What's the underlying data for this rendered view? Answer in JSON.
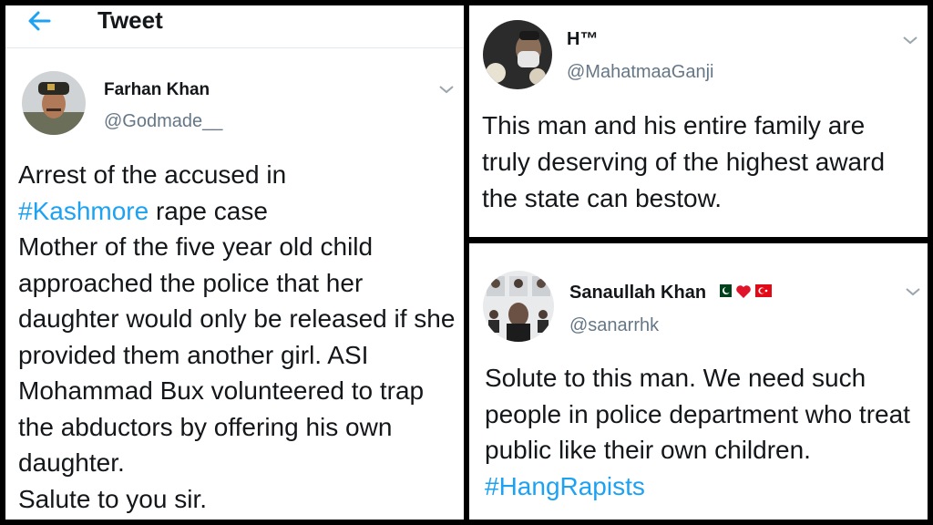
{
  "panel_left": {
    "header_title": "Tweet",
    "author_name": "Farhan Khan",
    "author_handle": "@Godmade__",
    "text_1": "Arrest of the accused in",
    "hashtag": "#Kashmore",
    "text_2": " rape case\nMother of the five year old child approached the police that her daughter would only be released if she provided them another girl. ASI Mohammad Bux volunteered to trap the abductors by offering his own daughter.\nSalute to you sir."
  },
  "panel_top_right": {
    "author_name": "H™",
    "author_handle": "@MahatmaaGanji",
    "text": "This man and his entire family are truly deserving of the highest award the state can bestow."
  },
  "panel_bottom_right": {
    "author_name": "Sanaullah Khan",
    "author_handle": "@sanarrhk",
    "text": "Solute to this man. We need such people in police department who treat public like their own children.",
    "hashtag": "#HangRapists"
  },
  "colors": {
    "link": "#1da1f2",
    "muted": "#657786",
    "text": "#14171a"
  },
  "icons": [
    "back-arrow-icon",
    "chevron-down-icon",
    "pakistan-flag-icon",
    "red-heart-icon",
    "turkey-flag-icon"
  ]
}
